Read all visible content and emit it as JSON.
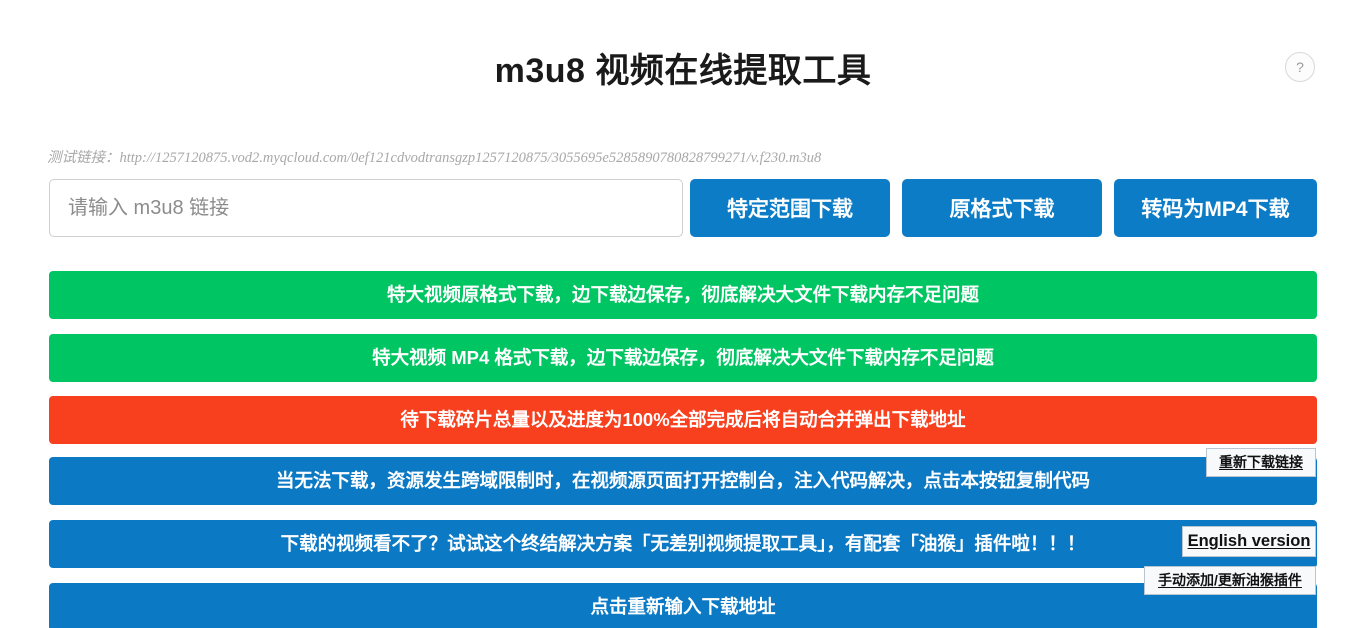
{
  "page": {
    "title": "m3u8 视频在线提取工具"
  },
  "help": {
    "icon_label": "?"
  },
  "test_link": {
    "label": "测试链接：",
    "url": "http://1257120875.vod2.myqcloud.com/0ef121cdvodtransgzp1257120875/3055695e5285890780828799271/v.f230.m3u8"
  },
  "search": {
    "value": "",
    "placeholder": "请输入 m3u8 链接"
  },
  "buttons": {
    "range_download": "特定范围下载",
    "original_download": "原格式下载",
    "mp4_download": "转码为MP4下载"
  },
  "banners": [
    {
      "text": "特大视频原格式下载，边下载边保存，彻底解决大文件下载内存不足问题",
      "color": "#00c563",
      "style": "green"
    },
    {
      "text": "特大视频 MP4 格式下载，边下载边保存，彻底解决大文件下载内存不足问题",
      "color": "#00c563",
      "style": "green"
    },
    {
      "text": "待下载碎片总量以及进度为100%全部完成后将自动合并弹出下载地址",
      "color": "#f8401f",
      "style": "red"
    },
    {
      "text": "当无法下载，资源发生跨域限制时，在视频源页面打开控制台，注入代码解决，点击本按钮复制代码",
      "color": "#0c79c4",
      "style": "blue"
    },
    {
      "text": "下载的视频看不了？试试这个终结解决方案「无差别视频提取工具」，有配套「油猴」插件啦！！！",
      "color": "#0c79c4",
      "style": "blue"
    },
    {
      "text": "点击重新输入下载地址",
      "color": "#0c79c4",
      "style": "blue"
    }
  ],
  "float_boxes": {
    "relink": "重新下载链接",
    "english": "English version",
    "tampermonkey": "手动添加/更新油猴插件"
  },
  "colors": {
    "accent_blue": "#0d7cc7",
    "banner_green": "#00c563",
    "banner_red": "#f8401f",
    "banner_blue": "#0c79c4"
  }
}
